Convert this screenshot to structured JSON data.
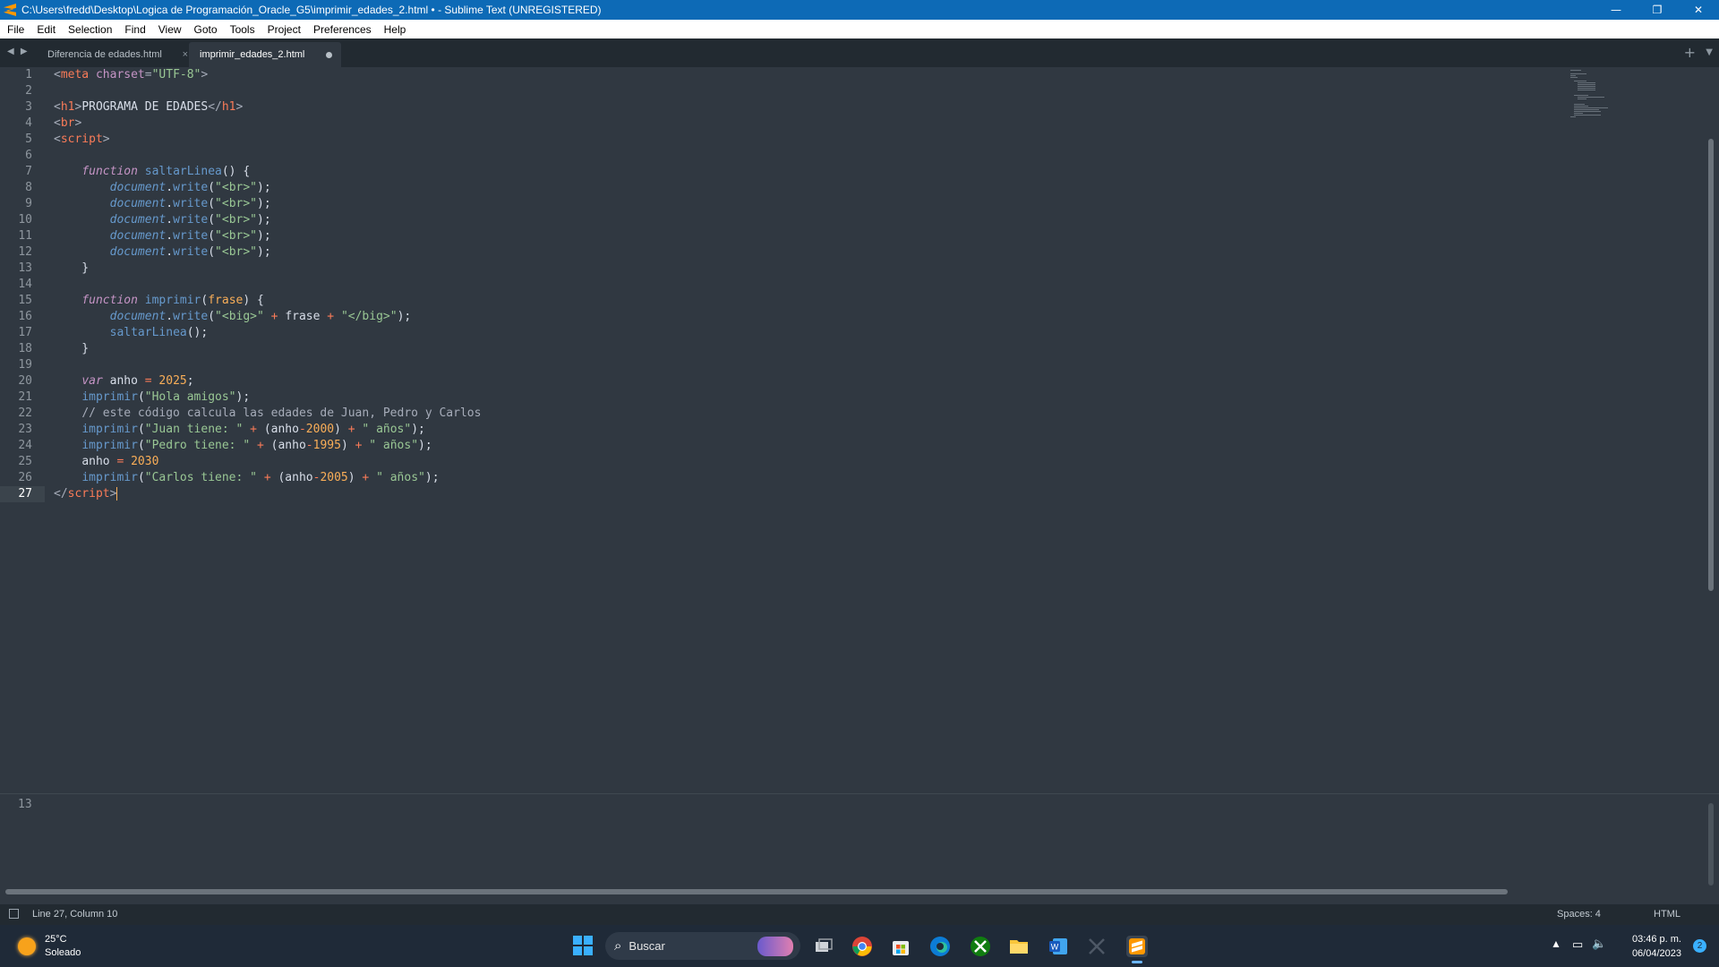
{
  "window": {
    "title": "C:\\Users\\fredd\\Desktop\\Logica de Programación_Oracle_G5\\imprimir_edades_2.html • - Sublime Text (UNREGISTERED)",
    "minimize": "—",
    "restore": "❐",
    "close": "✕"
  },
  "menu": [
    "File",
    "Edit",
    "Selection",
    "Find",
    "View",
    "Goto",
    "Tools",
    "Project",
    "Preferences",
    "Help"
  ],
  "tabs": [
    {
      "label": "Diferencia de edades.html",
      "active": false,
      "close": "×"
    },
    {
      "label": "imprimir_edades_2.html",
      "active": true,
      "dirty": true
    }
  ],
  "tabbar": {
    "nav": "◀ ▶",
    "new_tab": "+",
    "dropdown": "▼"
  },
  "editor": {
    "line_numbers": [
      "1",
      "2",
      "3",
      "4",
      "5",
      "6",
      "7",
      "8",
      "9",
      "10",
      "11",
      "12",
      "13",
      "14",
      "15",
      "16",
      "17",
      "18",
      "19",
      "20",
      "21",
      "22",
      "23",
      "24",
      "25",
      "26",
      "27"
    ],
    "current_line": 27,
    "code": {
      "l1": {
        "a": "<",
        "b": "meta",
        "c": " charset",
        "d": "=",
        "e": "\"UTF-8\"",
        "f": ">"
      },
      "l3": {
        "a": "<",
        "b": "h1",
        "c": ">",
        "d": "PROGRAMA DE EDADES",
        "e": "</",
        "f": "h1",
        "g": ">"
      },
      "l4": {
        "a": "<",
        "b": "br",
        "c": ">"
      },
      "l5": {
        "a": "<",
        "b": "script",
        "c": ">"
      },
      "l7": {
        "indent": "    ",
        "kw": "function",
        "name": " saltarLinea",
        "rest": "() {"
      },
      "write_line": {
        "indent": "        ",
        "obj": "document",
        "dot": ".",
        "method": "write",
        "open": "(",
        "str": "\"<br>\"",
        "close": ");"
      },
      "l13": "    }",
      "l15": {
        "indent": "    ",
        "kw": "function",
        "name": " imprimir",
        "p1": "(",
        "param": "frase",
        "p2": ") {"
      },
      "l16": {
        "indent": "        ",
        "obj": "document",
        "dot": ".",
        "method": "write",
        "open": "(",
        "s1": "\"<big>\"",
        "op1": " + ",
        "v": "frase",
        "op2": " + ",
        "s2": "\"</big>\"",
        "close": ");"
      },
      "l17": {
        "indent": "        ",
        "call": "saltarLinea",
        "rest": "();"
      },
      "l18": "    }",
      "l20": {
        "indent": "    ",
        "kw": "var",
        "v": " anho ",
        "op": "=",
        "n": " 2025",
        "end": ";"
      },
      "l21": {
        "indent": "    ",
        "call": "imprimir",
        "open": "(",
        "s": "\"Hola amigos\"",
        "close": ");"
      },
      "l22": {
        "indent": "    ",
        "comment": "// este código calcula las edades de Juan, Pedro y Carlos"
      },
      "l23": {
        "indent": "    ",
        "call": "imprimir",
        "open": "(",
        "s1": "\"Juan tiene: \"",
        "op1": " + ",
        "p": "(anho",
        "op2": "-",
        "n": "2000",
        "pc": ")",
        "op3": " + ",
        "s2": "\" años\"",
        "close": ");"
      },
      "l24": {
        "indent": "    ",
        "call": "imprimir",
        "open": "(",
        "s1": "\"Pedro tiene: \"",
        "op1": " + ",
        "p": "(anho",
        "op2": "-",
        "n": "1995",
        "pc": ")",
        "op3": " + ",
        "s2": "\" años\"",
        "close": ");"
      },
      "l25": {
        "indent": "    ",
        "v": "anho ",
        "op": "=",
        "n": " 2030"
      },
      "l26": {
        "indent": "    ",
        "call": "imprimir",
        "open": "(",
        "s1": "\"Carlos tiene: \"",
        "op1": " + ",
        "p": "(anho",
        "op2": "-",
        "n": "2005",
        "pc": ")",
        "op3": " + ",
        "s2": "\" años\"",
        "close": ");"
      },
      "l27": {
        "a": "</",
        "b": "script",
        "c": ">"
      }
    }
  },
  "output_panel": {
    "line_number": "13"
  },
  "statusbar": {
    "position": "Line 27, Column 10",
    "spaces": "Spaces: 4",
    "syntax": "HTML"
  },
  "taskbar": {
    "weather_temp": "25°C",
    "weather_desc": "Soleado",
    "search_placeholder": "Buscar",
    "time": "03:46 p. m.",
    "date": "06/04/2023",
    "notifications": "2",
    "icons": [
      "start-icon",
      "task-view-icon",
      "chrome-icon",
      "store-icon",
      "edge-icon",
      "xbox-icon",
      "file-explorer-icon",
      "word-icon",
      "snip-icon",
      "sublime-text-icon"
    ]
  },
  "colors": {
    "titlebar": "#0d6ab6",
    "editor_bg": "#303841",
    "tag": "#f97b58",
    "string": "#99c794",
    "keyword": "#c594c5",
    "function": "#6699cc",
    "number": "#f9ae58"
  }
}
